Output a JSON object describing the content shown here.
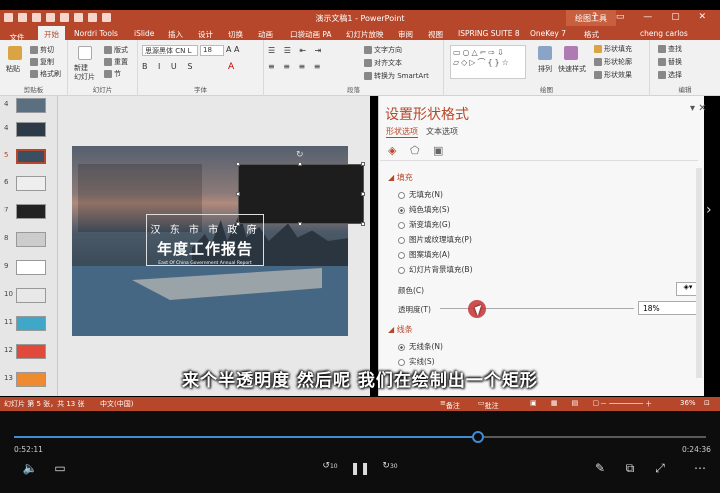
{
  "window": {
    "title": "演示文稿1 - PowerPoint",
    "context_tools": "绘图工具",
    "user": "cheng carlos"
  },
  "tabs": [
    "文件",
    "开始",
    "Nordri Tools",
    "iSlide",
    "插入",
    "设计",
    "切换",
    "动画",
    "口袋动画 PA",
    "幻灯片放映",
    "审阅",
    "视图",
    "ISPRING SUITE 8",
    "OneKey 7",
    "格式"
  ],
  "ribbon": {
    "clipboard": {
      "label": "剪贴板",
      "paste": "粘贴",
      "cut": "剪切",
      "copy": "复制",
      "painter": "格式刷"
    },
    "slides": {
      "label": "幻灯片",
      "new": "新建\n幻灯片",
      "layout": "版式",
      "reset": "重置",
      "section": "节"
    },
    "font": {
      "label": "字体",
      "name": "思源黑体 CN L",
      "size": "18"
    },
    "paragraph": {
      "label": "段落",
      "direction": "文字方向",
      "align": "对齐文本",
      "smartart": "转换为 SmartArt"
    },
    "drawing": {
      "label": "绘图",
      "arrange": "排列",
      "quickstyle": "快速样式",
      "fill": "形状填充",
      "outline": "形状轮廓",
      "effect": "形状效果"
    },
    "editing": {
      "label": "编辑",
      "find": "查找",
      "replace": "替换",
      "select": "选择"
    }
  },
  "thumbnails": [
    "4",
    "5",
    "6",
    "7",
    "8",
    "9",
    "10",
    "11",
    "12",
    "13"
  ],
  "slide": {
    "line1": "汉 东 市 市 政 府",
    "line2": "年度工作报告",
    "line3": "East Of China Government Annual Report"
  },
  "panel": {
    "title": "设置形状格式",
    "subtabs": [
      "形状选项",
      "文本选项"
    ],
    "fill_section": "填充",
    "fill_options": [
      "无填充(N)",
      "纯色填充(S)",
      "渐变填充(G)",
      "图片或纹理填充(P)",
      "图案填充(A)",
      "幻灯片背景填充(B)"
    ],
    "selected_fill": 1,
    "color_label": "颜色(C)",
    "transparency_label": "透明度(T)",
    "transparency_value": "18%",
    "line_section": "线条",
    "line_options": [
      "无线条(N)",
      "实线(S)"
    ]
  },
  "subtitle": "来个半透明度 然后呢 我们在绘制出一个矩形",
  "status": {
    "slide_info": "幻灯片 第 5 张，共 13 张",
    "lang": "中文(中国)",
    "notes": "备注",
    "comments": "批注",
    "zoom": "36%"
  },
  "player": {
    "current": "0:52:11",
    "duration": "0:24:36",
    "progress": 0.67,
    "skip_back": "10",
    "skip_fwd": "30"
  },
  "colors": {
    "accent": "#b7472a",
    "progress": "#3f8bd4"
  }
}
